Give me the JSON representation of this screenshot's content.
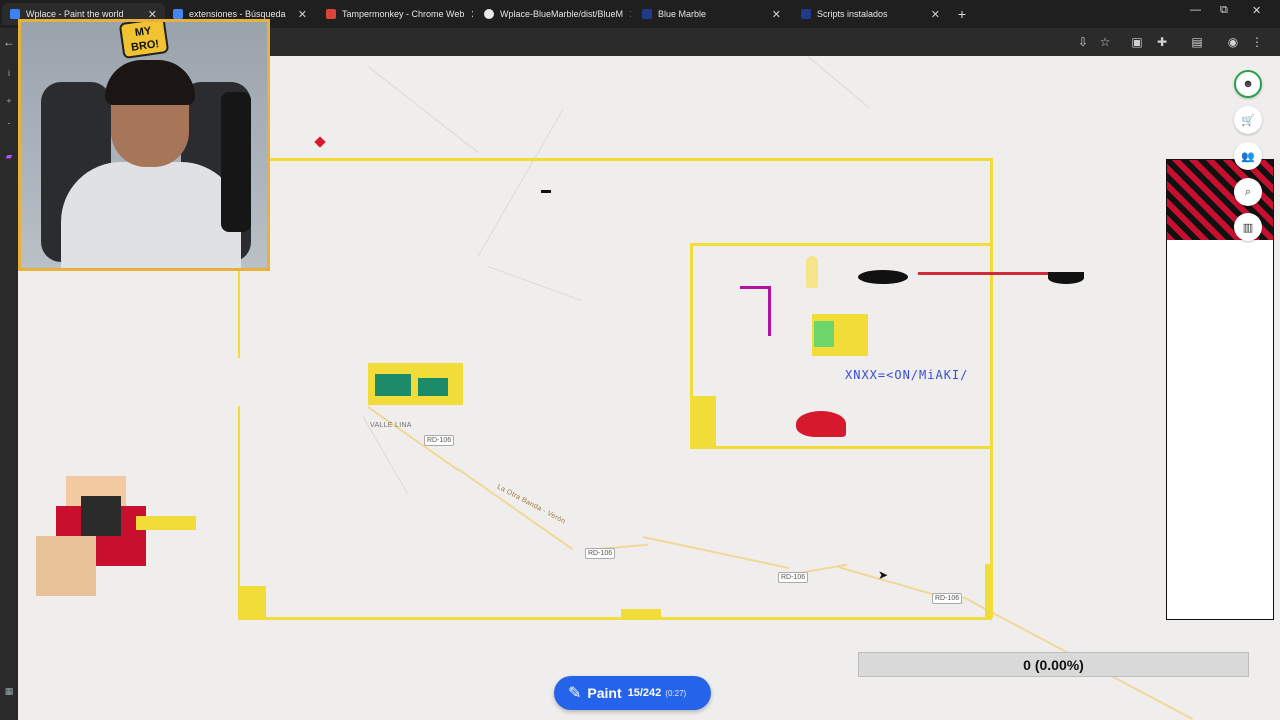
{
  "browser": {
    "tabs": [
      {
        "label": "Wplace - Paint the world",
        "active": true,
        "favicon_color": "#3b82f6"
      },
      {
        "label": "extensiones - Búsqueda",
        "active": false,
        "favicon_color": "#4285f4"
      },
      {
        "label": "Tampermonkey - Chrome Web",
        "active": false,
        "favicon_color": "#db4437"
      },
      {
        "label": "Wplace-BlueMarble/dist/BlueM",
        "active": false,
        "favicon_color": "#eaeaea"
      },
      {
        "label": "Blue Marble",
        "active": false,
        "favicon_color": "#1e3a8a"
      },
      {
        "label": "Scripts instalados",
        "active": false,
        "favicon_color": "#1e3a8a"
      }
    ],
    "new_tab_symbol": "+",
    "window_controls": [
      "—",
      "⧉",
      "✕"
    ]
  },
  "webcam": {
    "logo_text": "MY BRO!"
  },
  "map": {
    "place_label": "VALLE LINA",
    "road_labels": [
      "RD-106",
      "RD-106",
      "RD-106",
      "RD-106"
    ],
    "road_name": "La Otra Banda - Verón",
    "overlay_text": "XNXX=<ON/MiAKI/"
  },
  "progress": {
    "text": "0 (0.00%)"
  },
  "paint_button": {
    "label": "Paint",
    "count": "15/242",
    "timer": "(0:27)"
  },
  "colors": {
    "accent": "#2563eb",
    "frame_yellow": "#f1dc3a",
    "webcam_border": "#e7b13b"
  }
}
